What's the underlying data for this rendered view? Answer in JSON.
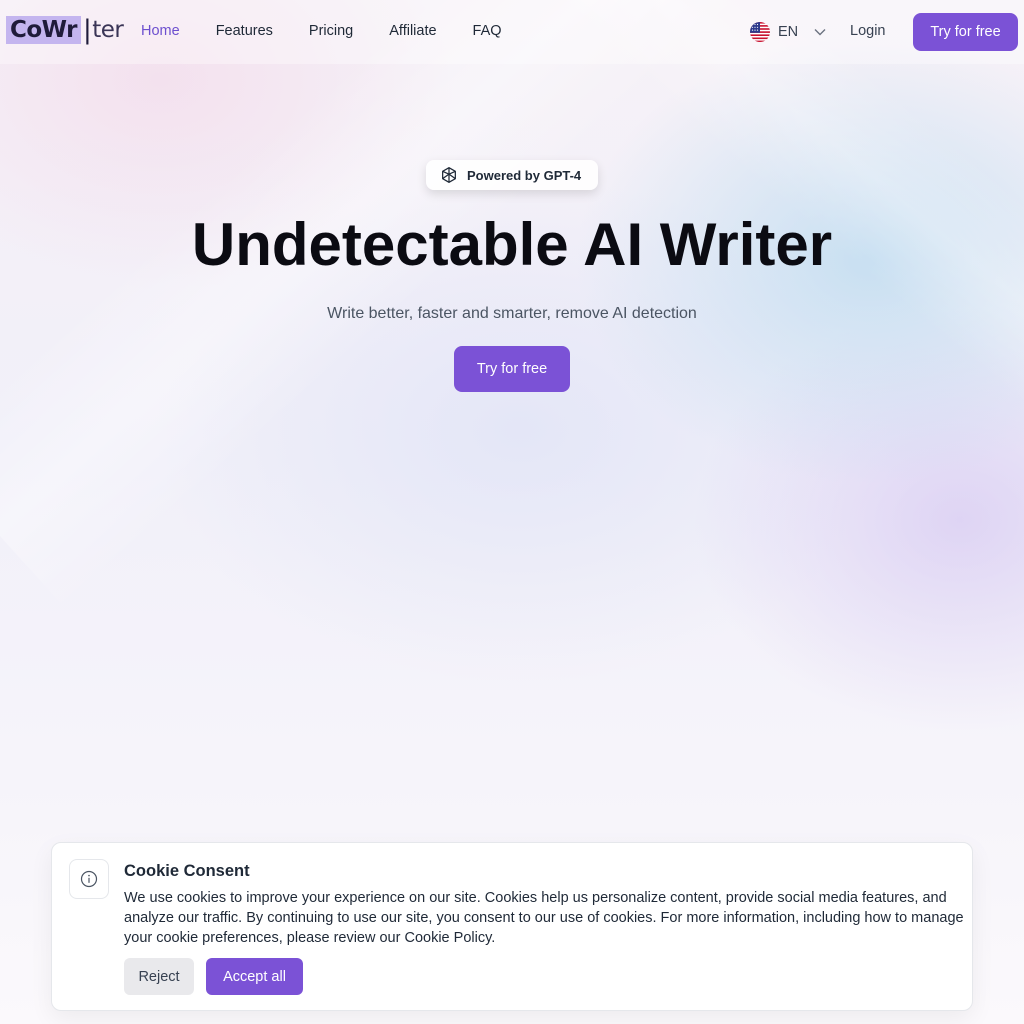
{
  "colors": {
    "accent": "#7b52d6",
    "nav_active": "#6d4fcf",
    "logo_highlight": "#c4b5ef"
  },
  "header": {
    "logo": {
      "highlight": "CoWr",
      "rest": "ter"
    },
    "nav": [
      {
        "label": "Home",
        "active": true
      },
      {
        "label": "Features",
        "active": false
      },
      {
        "label": "Pricing",
        "active": false
      },
      {
        "label": "Affiliate",
        "active": false
      },
      {
        "label": "FAQ",
        "active": false
      }
    ],
    "language": {
      "code": "EN",
      "flag_icon": "us-flag-icon",
      "chevron_icon": "chevron-down-icon"
    },
    "login_label": "Login",
    "cta_label": "Try for free"
  },
  "hero": {
    "badge": {
      "icon": "openai-logo-icon",
      "label": "Powered by GPT-4"
    },
    "title": "Undetectable AI Writer",
    "subtitle": "Write better, faster and smarter, remove AI detection",
    "cta_label": "Try for free"
  },
  "cookie": {
    "icon": "info-icon",
    "title": "Cookie Consent",
    "body": "We use cookies to improve your experience on our site. Cookies help us personalize content, provide social media features, and analyze our traffic. By continuing to use our site, you consent to our use of cookies. For more information, including how to manage your cookie preferences, please review our Cookie Policy.",
    "reject_label": "Reject",
    "accept_label": "Accept all"
  }
}
